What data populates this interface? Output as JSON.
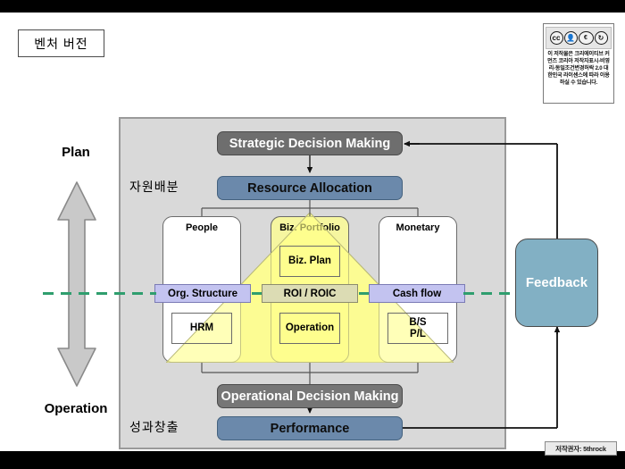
{
  "title_box": {
    "label": "벤처 버전"
  },
  "cc_badge": {
    "icons": [
      "cc-icon",
      "by-icon",
      "nc-icon",
      "sa-icon"
    ],
    "icon_glyphs": [
      "cc",
      "i",
      "₿",
      "↻"
    ],
    "sub_labels": [
      "BY",
      "NC",
      "SA"
    ],
    "license_text": "이 저작물은 크리에이티브 커먼즈 코리아 저작자표시-비영리-동일조건변경허락 2.0 대한민국 라이센스에 따라 이용하실 수 있습니다."
  },
  "copyright_tag": {
    "label": "저작권자: 5throck"
  },
  "side_axis": {
    "top_label": "Plan",
    "bottom_label": "Operation"
  },
  "kr_labels": {
    "resource": "자원배분",
    "performance": "성과창출"
  },
  "process_boxes": {
    "strategic_decision_making": "Strategic Decision Making",
    "resource_allocation": "Resource Allocation",
    "operational_decision_making": "Operational Decision Making",
    "performance": "Performance",
    "feedback": "Feedback"
  },
  "pillars": [
    {
      "title": "People",
      "inner": "HRM"
    },
    {
      "title": "Biz. Portfolio",
      "inner_top": "Biz. Plan",
      "inner_bottom": "Operation"
    },
    {
      "title": "Monetary",
      "inner": "B/S\nP/L"
    }
  ],
  "pillar_titles": {
    "people": "People",
    "biz_portfolio": "Biz. Portfolio",
    "monetary": "Monetary"
  },
  "inner_boxes": {
    "hrm": "HRM",
    "biz_plan": "Biz. Plan",
    "operation": "Operation",
    "bs": "B/S",
    "pl": "P/L"
  },
  "band": {
    "org_structure": "Org. Structure",
    "roi_roic": "ROI / ROIC",
    "cash_flow": "Cash flow"
  },
  "colors": {
    "panel_bg": "#d9d9d9",
    "dark_gray_box": "#6e6e6e",
    "steel_blue_box": "#6b89ab",
    "feedback_blue": "#82b0c4",
    "band_lavender": "#c3c3f0",
    "band_olive": "#dcdcb4",
    "triangle_yellow": "#ffff8c",
    "dash_green": "#2f9e6e",
    "letterbox_black": "#000000"
  }
}
